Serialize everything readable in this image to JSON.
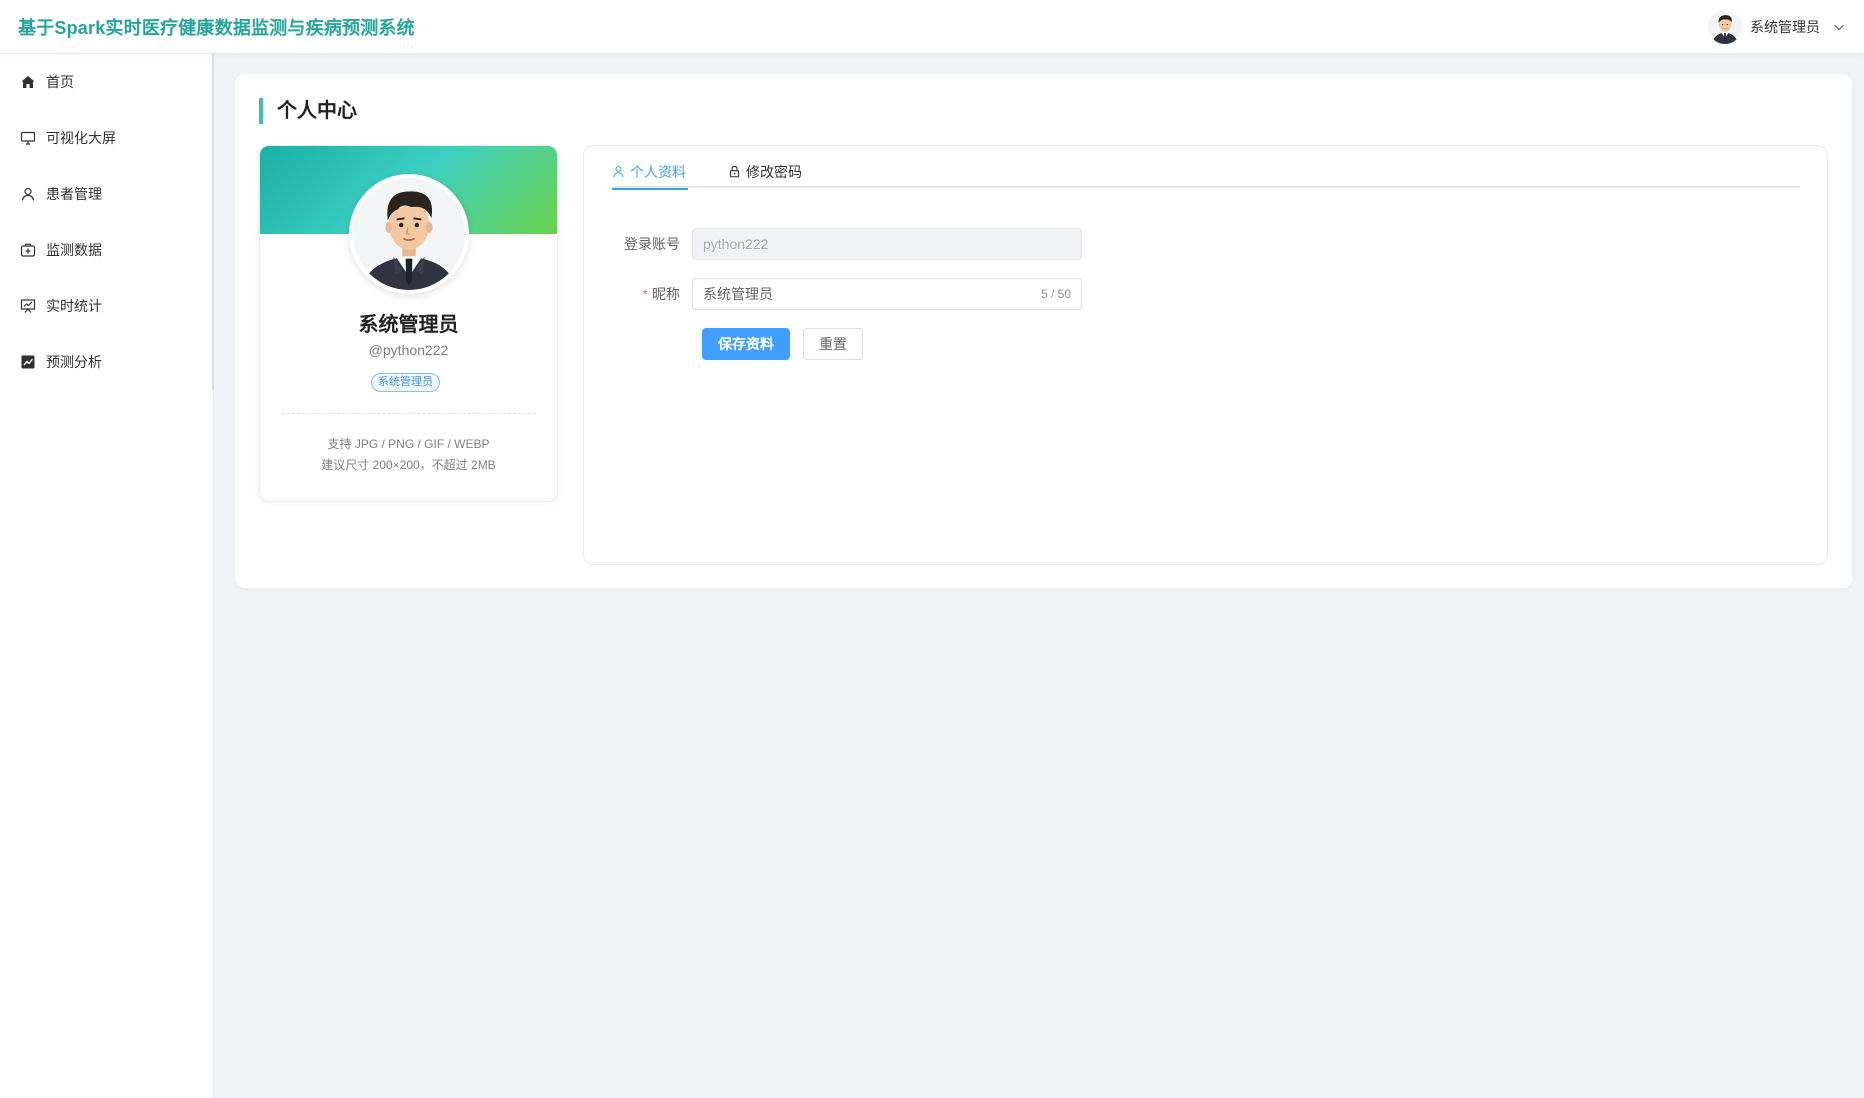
{
  "app": {
    "title": "基于Spark实时医疗健康数据监测与疾病预测系统"
  },
  "header": {
    "user_name": "系统管理员"
  },
  "sidebar": {
    "items": [
      {
        "label": "首页",
        "icon": "home-icon"
      },
      {
        "label": "可视化大屏",
        "icon": "monitor-icon"
      },
      {
        "label": "患者管理",
        "icon": "user-icon"
      },
      {
        "label": "监测数据",
        "icon": "medical-kit-icon"
      },
      {
        "label": "实时统计",
        "icon": "presentation-chart-icon"
      },
      {
        "label": "预测分析",
        "icon": "trend-chart-icon"
      }
    ]
  },
  "page": {
    "title": "个人中心"
  },
  "profile": {
    "name": "系统管理员",
    "handle": "@python222",
    "role": "系统管理员",
    "hint_formats": "支持 JPG / PNG / GIF / WEBP",
    "hint_size": "建议尺寸 200×200，不超过 2MB"
  },
  "tabs": [
    {
      "label": "个人资料",
      "icon": "user-icon",
      "active": true
    },
    {
      "label": "修改密码",
      "icon": "lock-icon",
      "active": false
    }
  ],
  "form": {
    "account_label": "登录账号",
    "account_value": "python222",
    "nickname_label": "昵称",
    "nickname_value": "系统管理员",
    "nickname_counter": "5 / 50",
    "save_label": "保存资料",
    "reset_label": "重置"
  },
  "colors": {
    "accent": "#26a69a",
    "primary": "#409eff",
    "banner_start": "#1ab0a6",
    "banner_end": "#6bd24e",
    "required": "#f56c6c"
  }
}
